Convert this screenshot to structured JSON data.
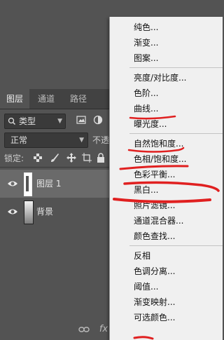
{
  "panel_tabs": [
    {
      "label": "图层",
      "active": true
    },
    {
      "label": "通道",
      "active": false
    },
    {
      "label": "路径",
      "active": false
    }
  ],
  "filter": {
    "kind_label": "类型"
  },
  "blend": {
    "mode": "正常",
    "opacity_label": "不透"
  },
  "lock": {
    "label": "锁定:"
  },
  "layers": [
    {
      "name": "图层 1",
      "selected": true,
      "visible": true
    },
    {
      "name": "背景",
      "selected": false,
      "visible": true
    }
  ],
  "bottom": {
    "fx_label": "fx"
  },
  "menu": {
    "groups": [
      [
        "纯色...",
        "渐变...",
        "图案..."
      ],
      [
        "亮度/对比度...",
        "色阶...",
        "曲线...",
        "曝光度..."
      ],
      [
        "自然饱和度...",
        "色相/饱和度...",
        "色彩平衡...",
        "黑白...",
        "照片滤镜...",
        "通道混合器...",
        "颜色查找..."
      ],
      [
        "反相",
        "色调分离...",
        "阈值...",
        "渐变映射...",
        "可选颜色..."
      ]
    ]
  },
  "colors": {
    "annotation": "#e02020",
    "menu_bg": "#f0f0f0",
    "panel_bg": "#535353"
  }
}
